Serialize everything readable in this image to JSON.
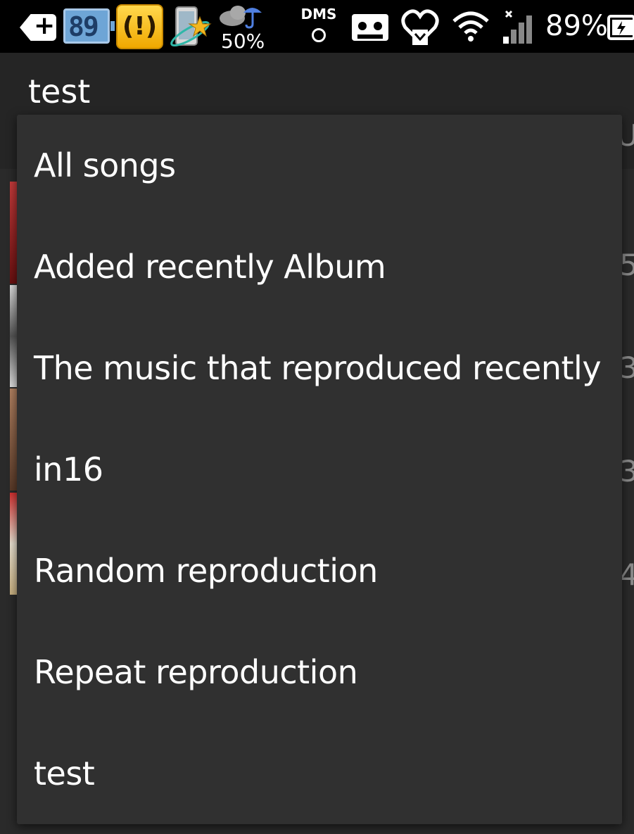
{
  "status_bar": {
    "battery_digits": "89",
    "alert_glyph": "(!)",
    "weather_pct": "50%",
    "dms_label": "DMS",
    "battery_pct": "89%",
    "icons": [
      "plus-badge-icon",
      "battery-widget-icon",
      "alert-icon",
      "phone-star-icon",
      "weather-icon",
      "dms-icon",
      "cassette-icon",
      "heart-icon",
      "wifi-icon",
      "signal-icon",
      "battery-icon"
    ]
  },
  "app_bar": {
    "title": "test"
  },
  "background_rows": {
    "partial_texts": [
      "U",
      "5",
      "3",
      "3",
      "4"
    ]
  },
  "menu": {
    "items": [
      {
        "label": "All songs"
      },
      {
        "label": "Added recently Album"
      },
      {
        "label": "The music that reproduced recently"
      },
      {
        "label": "in16"
      },
      {
        "label": "Random reproduction"
      },
      {
        "label": "Repeat reproduction"
      },
      {
        "label": "test"
      }
    ]
  },
  "colors": {
    "menu_bg": "#303030",
    "app_bar_bg": "#252525",
    "status_bar_bg": "#000000",
    "text": "#ffffff"
  }
}
